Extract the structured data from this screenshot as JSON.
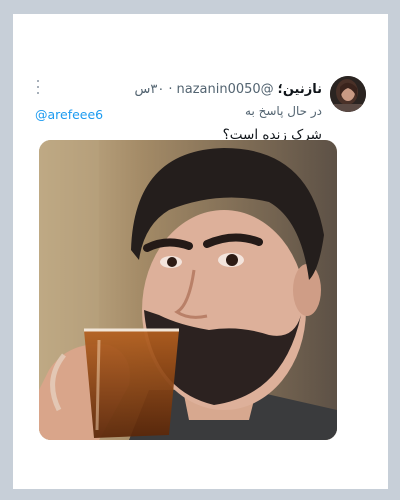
{
  "tweet": {
    "display_name": "نازنین؛",
    "handle": "@nazanin0050",
    "separator": "·",
    "time": "۳۰س",
    "reply_prefix": "در حال پاسخ به",
    "reply_to": "@arefeee6",
    "text": "شرک زنده است؟",
    "more_icon": "more-vertical-icon",
    "media": "photo"
  },
  "colors": {
    "background": "#c7cfd8",
    "card": "#ffffff",
    "text": "#0f1419",
    "muted": "#536471",
    "link": "#1d9bf0"
  }
}
